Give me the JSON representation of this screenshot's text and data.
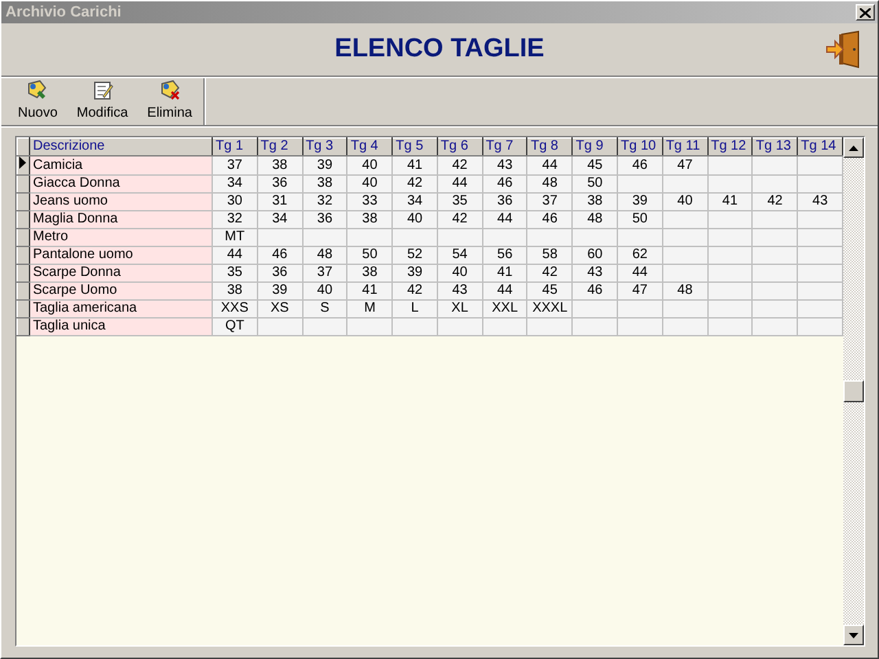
{
  "window": {
    "title": "Archivio Carichi"
  },
  "header": {
    "title": "ELENCO TAGLIE"
  },
  "toolbar": [
    {
      "label": "Nuovo",
      "kind": "new"
    },
    {
      "label": "Modifica",
      "kind": "edit"
    },
    {
      "label": "Elimina",
      "kind": "delete"
    }
  ],
  "table": {
    "columns": [
      "Descrizione",
      "Tg 1",
      "Tg 2",
      "Tg 3",
      "Tg 4",
      "Tg 5",
      "Tg 6",
      "Tg 7",
      "Tg 8",
      "Tg 9",
      "Tg 10",
      "Tg 11",
      "Tg 12",
      "Tg 13",
      "Tg 14"
    ],
    "rows": [
      {
        "selected": true,
        "description": "Camicia",
        "sizes": [
          "37",
          "38",
          "39",
          "40",
          "41",
          "42",
          "43",
          "44",
          "45",
          "46",
          "47"
        ]
      },
      {
        "selected": false,
        "description": "Giacca Donna",
        "sizes": [
          "34",
          "36",
          "38",
          "40",
          "42",
          "44",
          "46",
          "48",
          "50"
        ]
      },
      {
        "selected": false,
        "description": "Jeans uomo",
        "sizes": [
          "30",
          "31",
          "32",
          "33",
          "34",
          "35",
          "36",
          "37",
          "38",
          "39",
          "40",
          "41",
          "42",
          "43"
        ]
      },
      {
        "selected": false,
        "description": "Maglia Donna",
        "sizes": [
          "32",
          "34",
          "36",
          "38",
          "40",
          "42",
          "44",
          "46",
          "48",
          "50"
        ]
      },
      {
        "selected": false,
        "description": "Metro",
        "sizes": [
          "MT"
        ]
      },
      {
        "selected": false,
        "description": "Pantalone uomo",
        "sizes": [
          "44",
          "46",
          "48",
          "50",
          "52",
          "54",
          "56",
          "58",
          "60",
          "62"
        ]
      },
      {
        "selected": false,
        "description": "Scarpe Donna",
        "sizes": [
          "35",
          "36",
          "37",
          "38",
          "39",
          "40",
          "41",
          "42",
          "43",
          "44"
        ]
      },
      {
        "selected": false,
        "description": "Scarpe Uomo",
        "sizes": [
          "38",
          "39",
          "40",
          "41",
          "42",
          "43",
          "44",
          "45",
          "46",
          "47",
          "48"
        ]
      },
      {
        "selected": false,
        "description": "Taglia americana",
        "sizes": [
          "XXS",
          "XS",
          "S",
          "M",
          "L",
          "XL",
          "XXL",
          "XXXL"
        ]
      },
      {
        "selected": false,
        "description": "Taglia unica",
        "sizes": [
          "QT"
        ]
      }
    ]
  }
}
